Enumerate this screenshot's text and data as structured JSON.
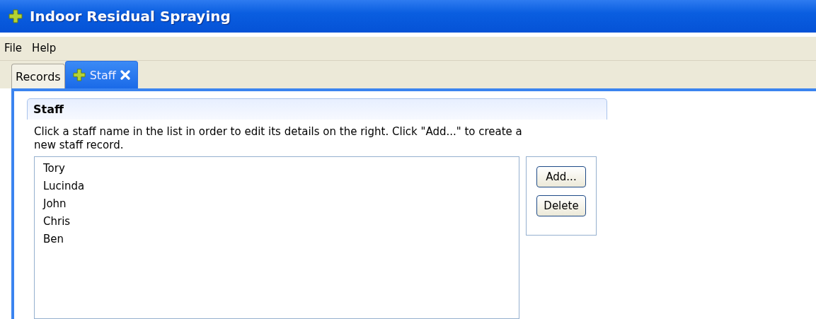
{
  "window": {
    "title": "Indoor Residual Spraying"
  },
  "menu": [
    "File",
    "Help"
  ],
  "tabs": [
    {
      "label": "Records",
      "selected": false,
      "closable": false,
      "icon": false
    },
    {
      "label": "Staff",
      "selected": true,
      "closable": true,
      "icon": true
    }
  ],
  "section": {
    "title": "Staff",
    "description": "Click a staff name in the list in order to edit its details on the right. Click \"Add...\" to create a new staff record."
  },
  "staff_list": [
    {
      "name": "Tory",
      "selected": false
    },
    {
      "name": "Lucinda",
      "selected": false
    },
    {
      "name": "John",
      "selected": false
    },
    {
      "name": "Chris",
      "selected": false
    },
    {
      "name": "Ben",
      "selected": false
    }
  ],
  "buttons": [
    "Add...",
    "Delete"
  ]
}
